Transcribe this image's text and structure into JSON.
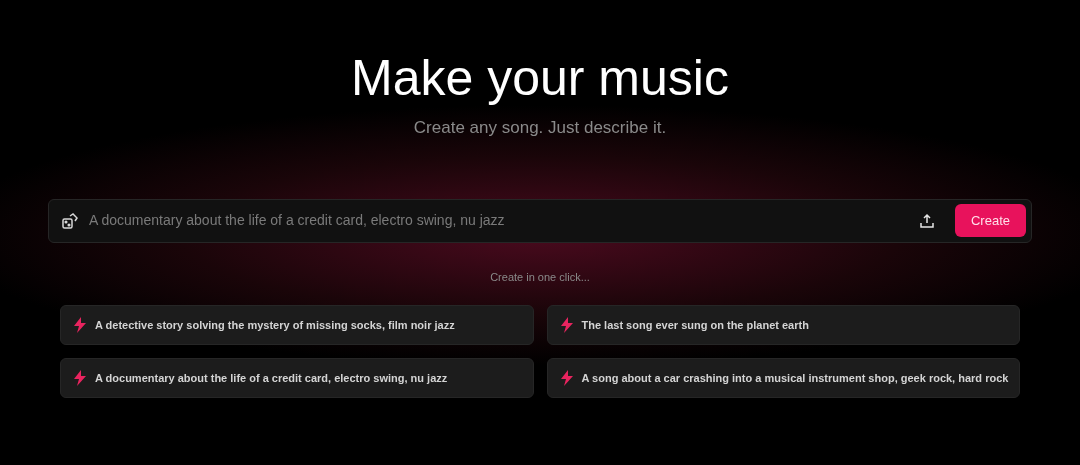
{
  "title": "Make your music",
  "subtitle": "Create any song. Just describe it.",
  "prompt": {
    "placeholder": "A documentary about the life of a credit card, electro swing, nu jazz",
    "button": "Create"
  },
  "suggestions_heading": "Create in one click...",
  "suggestions": [
    {
      "text": "A detective story solving the mystery of missing socks, film noir jazz"
    },
    {
      "text": "The last song ever sung on the planet earth"
    },
    {
      "text": "A documentary about the life of a credit card, electro swing, nu jazz"
    },
    {
      "text": "A song about a car crashing into a musical instrument shop, geek rock, hard rock"
    }
  ]
}
